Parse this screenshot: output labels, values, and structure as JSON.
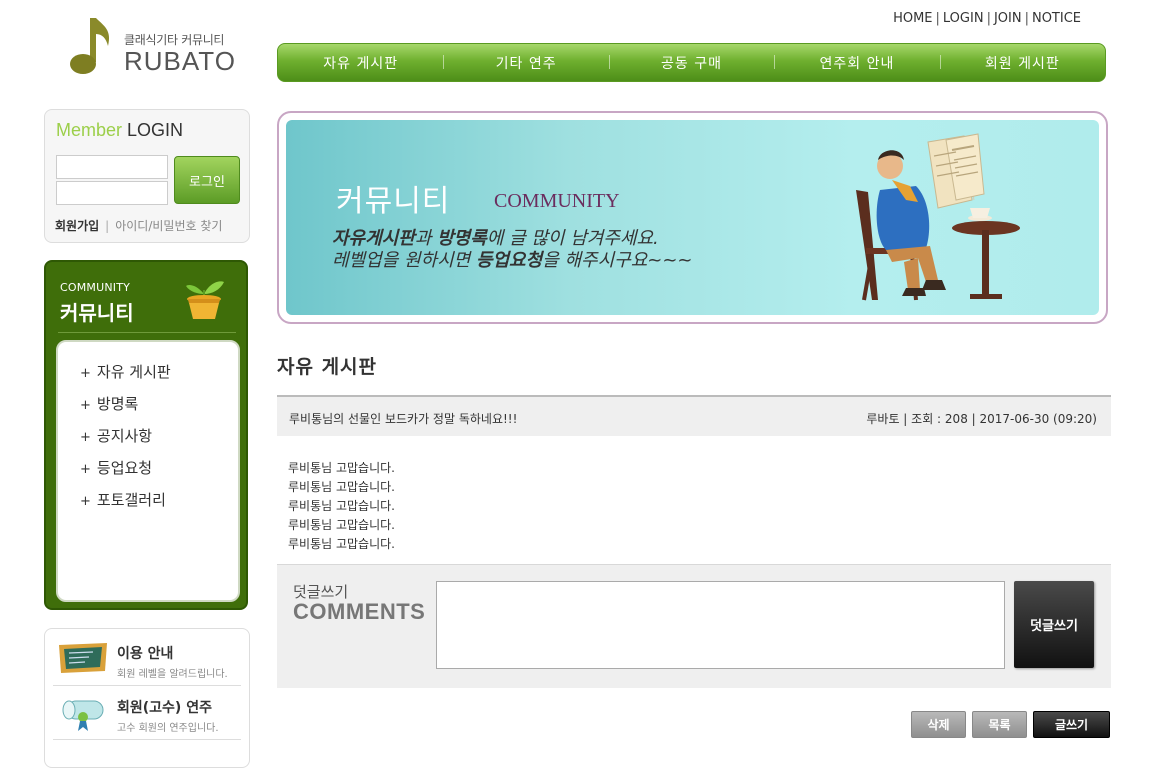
{
  "header": {
    "logo_subtitle": "클래식기타 커뮤니티",
    "logo_brand": "RUBATO",
    "top_links": [
      "HOME",
      "LOGIN",
      "JOIN",
      "NOTICE"
    ],
    "top_sep": "|"
  },
  "gnb": [
    "자유 게시판",
    "기타 연주",
    "공동 구매",
    "연주회 안내",
    "회원 게시판"
  ],
  "login": {
    "title_member": "Member",
    "title_login": "LOGIN",
    "button": "로그인",
    "join": "회원가입",
    "sep": "|",
    "find": "아이디/비밀번호 찾기"
  },
  "community": {
    "title_en": "COMMUNITY",
    "title_ko": "커뮤니티",
    "plus": "+",
    "items": [
      "자유 게시판",
      "방명록",
      "공지사항",
      "등업요청",
      "포토갤러리"
    ]
  },
  "info": [
    {
      "title": "이용 안내",
      "desc": "회원 레벨을 알려드립니다."
    },
    {
      "title": "회원(고수) 연주",
      "desc": "고수 회원의 연주입니다."
    }
  ],
  "banner": {
    "title_ko": "커뮤니티",
    "title_en": "COMMUNITY",
    "line1_b1": "자유게시판",
    "line1_t1": "과 ",
    "line1_b2": "방명록",
    "line1_t2": "에 글 많이 남겨주세요.",
    "line2_t1": "레벨업을 원하시면 ",
    "line2_b1": "등업요청",
    "line2_t2": "을 해주시구요~~~"
  },
  "board": {
    "title": "자유 게시판",
    "subject": "루비통님의 선물인 보드카가 정말 독하네요!!!",
    "meta": "루바토 | 조회 : 208 | 2017-06-30 (09:20)",
    "body": [
      "루비통님 고맙습니다.",
      "루비통님 고맙습니다.",
      "루비통님 고맙습니다.",
      "루비통님 고맙습니다.",
      "루비통님 고맙습니다."
    ]
  },
  "comments": {
    "label_ko": "덧글쓰기",
    "label_en": "COMMENTS",
    "button": "덧글쓰기",
    "value": ""
  },
  "actions": {
    "delete": "삭제",
    "list": "목록",
    "write": "글쓰기"
  },
  "colors": {
    "accent_green": "#6fb02f",
    "community_bg": "#3f6e0a",
    "banner_bg": "#9fe0e0",
    "banner_border": "#c8a6c4"
  }
}
